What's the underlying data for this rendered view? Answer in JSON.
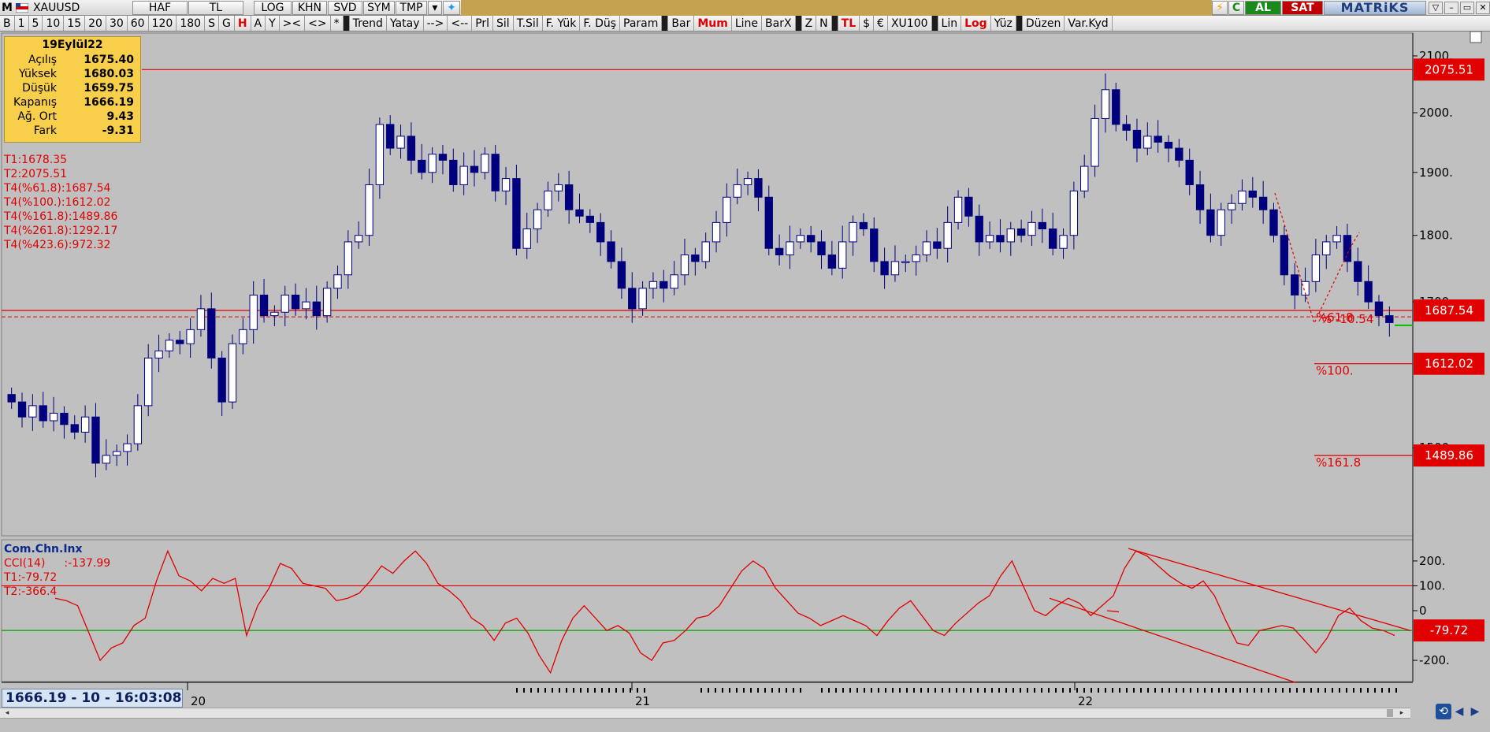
{
  "toolbar": {
    "logo": "M",
    "symbol": "XAUUSD",
    "items": [
      "HAF",
      "TL",
      "LOG",
      "KHN",
      "SVD",
      "SYM",
      "TMP"
    ],
    "al_label": "AL",
    "sat_label": "SAT",
    "brand": "MATRiKS"
  },
  "periods": [
    "B",
    "1",
    "5",
    "10",
    "15",
    "20",
    "30",
    "60",
    "120",
    "180",
    "S",
    "G",
    "H",
    "A",
    "Y",
    "><",
    "<>",
    "*",
    "Trend",
    "Yatay",
    "-->",
    "<--",
    "Prl",
    "Sil",
    "T.Sil",
    "F. Yük",
    "F. Düş",
    "Param",
    "Bar",
    "Mum",
    "Line",
    "BarX",
    "Z",
    "N",
    "TL",
    "$",
    "€",
    "XU100",
    "Lin",
    "Log",
    "Yüz",
    "Düzen",
    "Var.Kyd"
  ],
  "period_active": [
    "H",
    "Mum",
    "TL",
    "Log"
  ],
  "info": {
    "date": "19Eylül22",
    "rows": [
      {
        "k": "Açılış",
        "v": "1675.40"
      },
      {
        "k": "Yüksek",
        "v": "1680.03"
      },
      {
        "k": "Düşük",
        "v": "1659.75"
      },
      {
        "k": "Kapanış",
        "v": "1666.19"
      },
      {
        "k": "Ağ. Ort",
        "v": "9.43"
      },
      {
        "k": "Fark",
        "v": "-9.31"
      }
    ]
  },
  "tlevels": [
    "T1:1678.35",
    "T2:2075.51",
    "T4(%61.8):1687.54",
    "T4(%100.):1612.02",
    "T4(%161.8):1489.86",
    "T4(%261.8):1292.17",
    "T4(%423.6):972.32"
  ],
  "cci": {
    "name": "Com.Chn.Inx",
    "label": "CCI(14)",
    "value": ":-137.99",
    "t1": "T1:-79.72",
    "t2": "T2:-366.4"
  },
  "status": "1666.19 - 10 - 16:03:08",
  "colors": {
    "up": "#ffffff",
    "down": "#00007f",
    "level": "#e00000",
    "marker_green": "#00c000",
    "bg": "#c0c0c0"
  },
  "chart_data": [
    {
      "type": "candlestick",
      "symbol": "XAUUSD",
      "y_ticks": [
        2100,
        2000,
        1900,
        1800,
        1700,
        1500
      ],
      "y_scale": "log",
      "x_ticks": [
        "20",
        "21",
        "22"
      ],
      "horizontal_levels": [
        {
          "value": 2075.51,
          "label": "2075.51"
        },
        {
          "value": 1687.54,
          "label": "1687.54",
          "text": "%61.8"
        },
        {
          "value": 1612.02,
          "label": "1612.02",
          "text": "%100."
        },
        {
          "value": 1489.86,
          "label": "1489.86",
          "text": "%161.8"
        }
      ],
      "annotation": "% -10.54",
      "close_approx": [
        1560,
        1540,
        1555,
        1535,
        1545,
        1530,
        1520,
        1540,
        1480,
        1490,
        1495,
        1505,
        1555,
        1620,
        1630,
        1645,
        1640,
        1660,
        1690,
        1620,
        1560,
        1640,
        1660,
        1710,
        1680,
        1685,
        1710,
        1690,
        1700,
        1680,
        1720,
        1740,
        1790,
        1800,
        1880,
        1980,
        1940,
        1960,
        1920,
        1900,
        1930,
        1920,
        1880,
        1910,
        1900,
        1930,
        1870,
        1890,
        1780,
        1810,
        1840,
        1870,
        1880,
        1840,
        1830,
        1820,
        1790,
        1760,
        1720,
        1690,
        1720,
        1730,
        1720,
        1740,
        1770,
        1760,
        1790,
        1820,
        1860,
        1880,
        1890,
        1860,
        1780,
        1770,
        1790,
        1800,
        1790,
        1770,
        1750,
        1790,
        1820,
        1810,
        1760,
        1740,
        1760,
        1760,
        1770,
        1790,
        1780,
        1820,
        1860,
        1830,
        1790,
        1800,
        1790,
        1810,
        1800,
        1820,
        1810,
        1780,
        1800,
        1870,
        1910,
        1990,
        2040,
        1980,
        1970,
        1940,
        1960,
        1950,
        1940,
        1920,
        1880,
        1840,
        1800,
        1840,
        1850,
        1870,
        1860,
        1840,
        1800,
        1740,
        1710,
        1730,
        1770,
        1790,
        1800,
        1760,
        1730,
        1700,
        1680,
        1670
      ]
    },
    {
      "type": "line",
      "name": "CCI(14)",
      "y_ticks": [
        200,
        100,
        0,
        -200
      ],
      "horizontal_levels": [
        {
          "value": 100,
          "color": "#e00000"
        },
        {
          "value": -79.72,
          "color": "#00a000",
          "label": "-79.72"
        }
      ],
      "values": [
        50,
        40,
        20,
        -90,
        -200,
        -150,
        -130,
        -60,
        -30,
        120,
        240,
        140,
        120,
        80,
        130,
        110,
        130,
        -100,
        20,
        90,
        190,
        170,
        110,
        100,
        90,
        40,
        50,
        70,
        120,
        180,
        150,
        200,
        240,
        190,
        110,
        80,
        40,
        -30,
        -60,
        -120,
        -50,
        -30,
        -90,
        -180,
        -250,
        -120,
        -30,
        20,
        -30,
        -80,
        -60,
        -90,
        -170,
        -200,
        -130,
        -120,
        -80,
        -30,
        -20,
        20,
        90,
        160,
        200,
        170,
        90,
        40,
        -10,
        -30,
        -60,
        -40,
        -20,
        -40,
        -60,
        -100,
        -40,
        10,
        40,
        -20,
        -80,
        -100,
        -50,
        -10,
        30,
        60,
        140,
        200,
        100,
        0,
        -20,
        20,
        50,
        30,
        -20,
        20,
        60,
        170,
        240,
        220,
        180,
        140,
        110,
        90,
        120,
        60,
        -40,
        -130,
        -140,
        -80,
        -70,
        -60,
        -70,
        -120,
        -170,
        -110,
        -20,
        10,
        -40,
        -70,
        -80,
        -100
      ],
      "trendlines": 3
    }
  ]
}
